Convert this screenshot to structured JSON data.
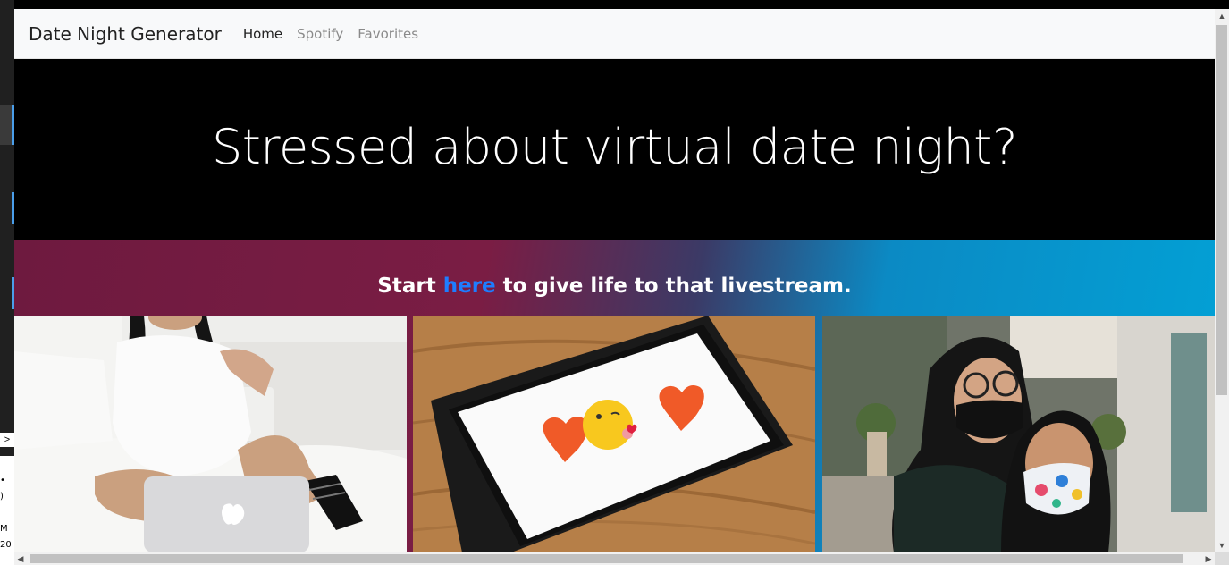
{
  "navbar": {
    "brand": "Date Night Generator",
    "links": [
      {
        "label": "Home",
        "active": true
      },
      {
        "label": "Spotify",
        "active": false
      },
      {
        "label": "Favorites",
        "active": false
      }
    ]
  },
  "hero": {
    "heading": "Stressed about virtual date night?"
  },
  "cta": {
    "before": "Start ",
    "link": "here",
    "after": " to give life to that livestream."
  },
  "cards": [
    {
      "icon": "woman-with-laptop-photo"
    },
    {
      "icon": "phone-with-heart-emojis-photo"
    },
    {
      "icon": "couple-wearing-masks-photo"
    }
  ],
  "colors": {
    "navbar_bg": "#f8f9fa",
    "hero_bg": "#000000",
    "link_accent": "#1e7dff",
    "gradient_left": "#7a1d44",
    "gradient_right": "#02a2d6"
  },
  "os_tray": {
    "chevron": ">",
    "text_a": "M",
    "text_b": "20"
  },
  "scrollbar": {
    "up": "▲",
    "down": "▼",
    "left": "◀",
    "right": "▶"
  }
}
